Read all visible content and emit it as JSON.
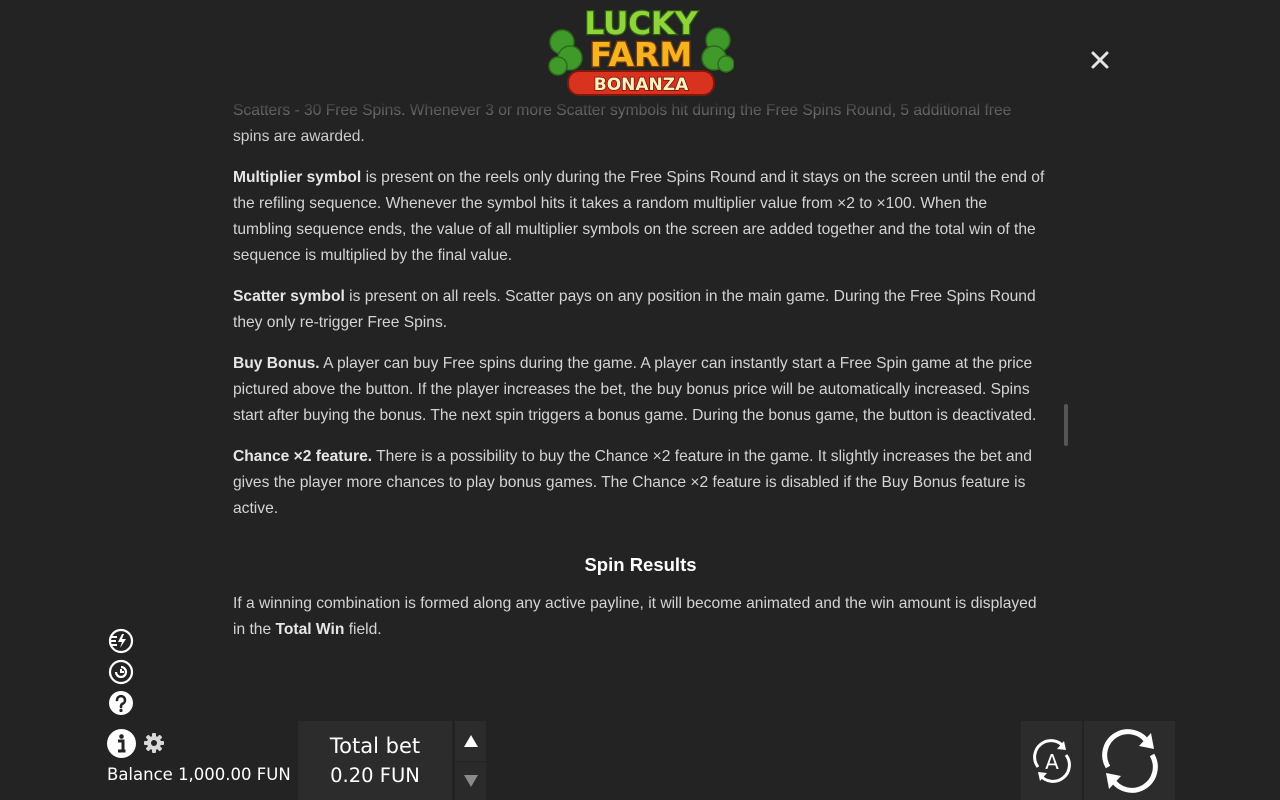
{
  "logo": {
    "line1": "LUCKY",
    "line2": "FARM",
    "line3": "BONANZA"
  },
  "close_icon": "close-icon",
  "content": {
    "intro": "Scatters - 30 Free Spins. Whenever 3 or more Scatter symbols hit during the Free Spins Round, 5 additional free spins are awarded.",
    "multiplier_title": "Multiplier symbol",
    "multiplier_text": " is present on the reels only during the Free Spins Round and it stays on the screen until the end of the refiling sequence. Whenever the symbol hits it takes a random multiplier value from ×2 to ×100. When the tumbling sequence ends, the value of all multiplier symbols on the screen are added together and the total win of the sequence is multiplied by the final value.",
    "scatter_title": "Scatter symbol",
    "scatter_text": " is present on all reels. Scatter pays on any position in the main game. During the Free Spins Round they only re-trigger Free Spins.",
    "buy_title": "Buy Bonus.",
    "buy_text": " A player can buy Free spins during the game. A player can instantly start a Free Spin game at the price pictured above the button. If the player increases the bet, the buy bonus price will be automatically increased. Spins start after buying the bonus. The next spin triggers a bonus game. During the bonus game, the button is deactivated.",
    "chance_title": "Chance ×2 feature.",
    "chance_text": " There is a possibility to buy the Chance ×2 feature in the game. It slightly increases the bet and gives the player more chances to play bonus games. The Chance ×2 feature is disabled if the Buy Bonus feature is active.",
    "spin_results_title": "Spin Results",
    "spin_results_text_a": "If a winning combination is formed along any active payline, it will become animated and the win amount is displayed in the ",
    "spin_results_bold": "Total Win",
    "spin_results_text_b": " field."
  },
  "footer": {
    "balance_label": "Balance",
    "balance_value": "1,000.00 FUN",
    "total_bet_label": "Total bet",
    "total_bet_value": "0.20 FUN",
    "auto_label": "A"
  },
  "icons": [
    "turbo-icon",
    "history-icon",
    "help-icon",
    "info-icon",
    "gear-icon",
    "arrow-up-icon",
    "arrow-down-icon",
    "autoplay-icon",
    "spin-icon"
  ],
  "colors": {
    "background": "#232323",
    "text": "#d4d4d4",
    "panel": "#2c2c2c",
    "logo_green": "#8fd43a",
    "logo_orange": "#f47a1c",
    "logo_red": "#d9331f"
  }
}
